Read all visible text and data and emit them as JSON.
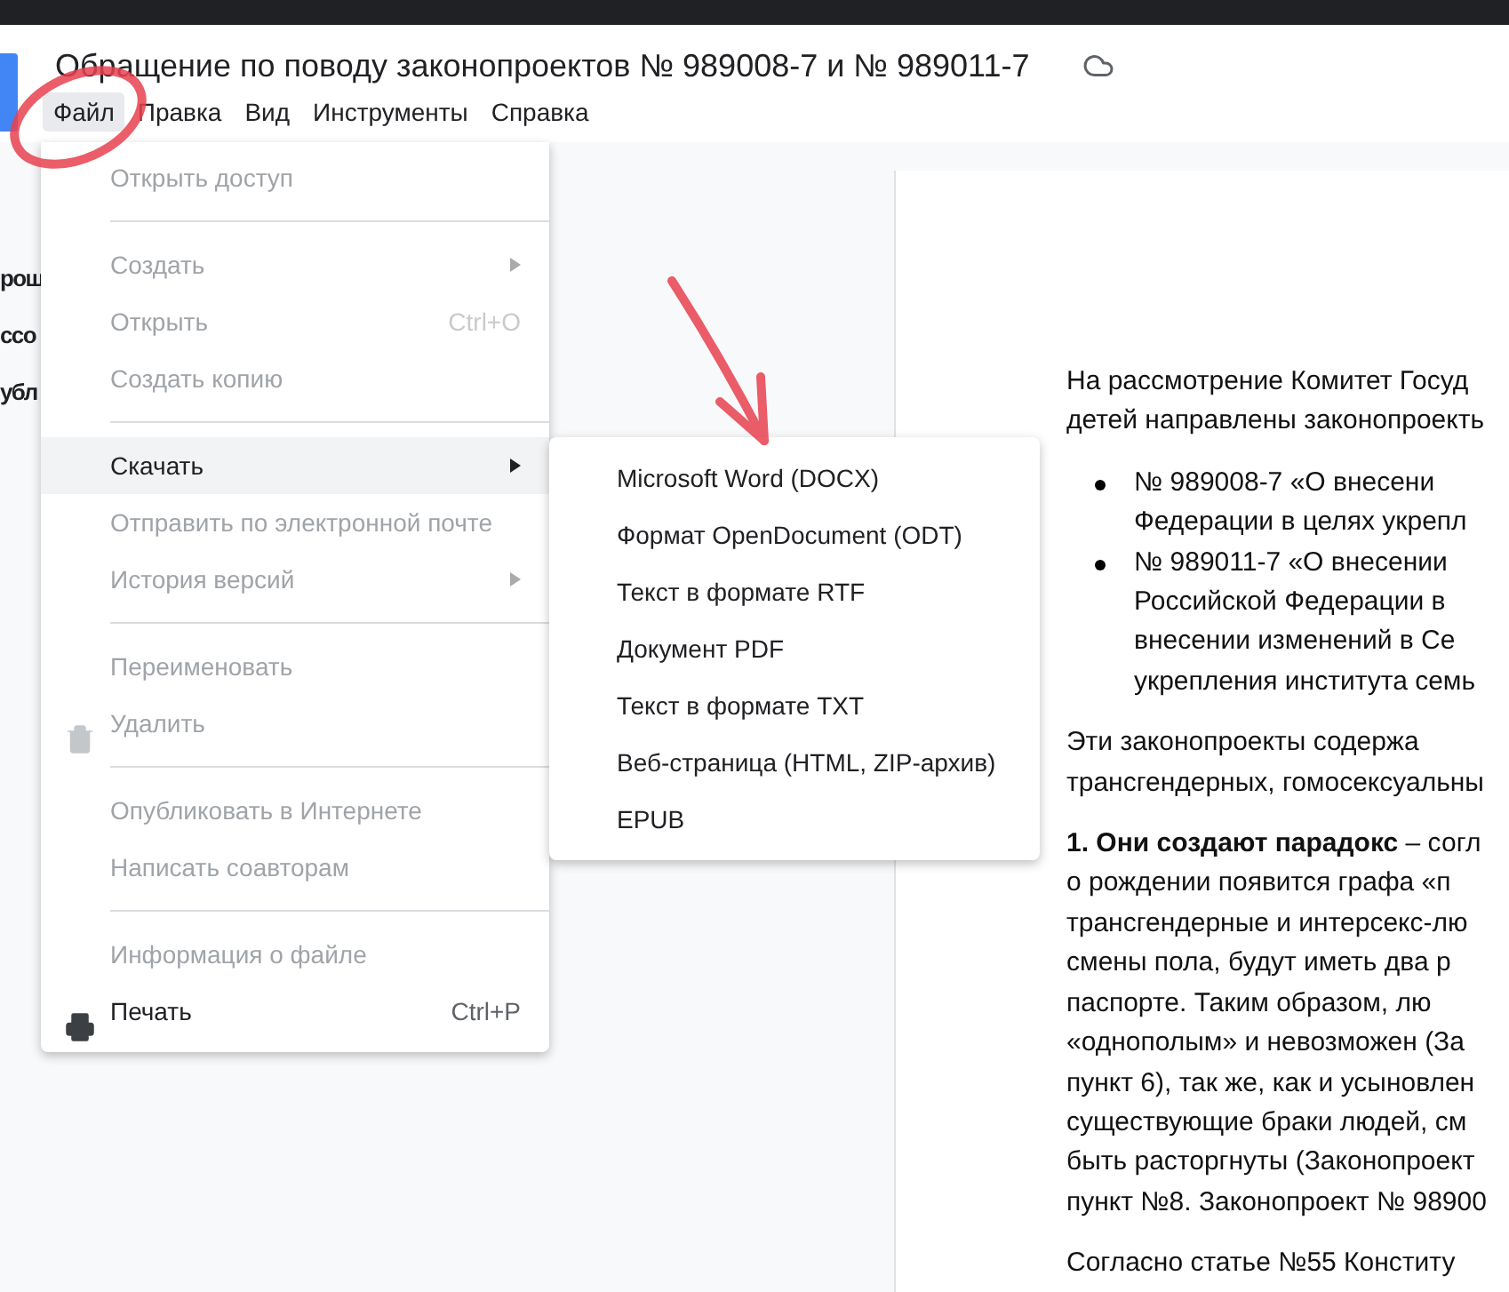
{
  "document_title": "Обращение по поводу законопроектов № 989008-7 и № 989011-7",
  "menubar": [
    {
      "label": "Файл",
      "selected": true
    },
    {
      "label": "Правка",
      "selected": false
    },
    {
      "label": "Вид",
      "selected": false
    },
    {
      "label": "Инструменты",
      "selected": false
    },
    {
      "label": "Справка",
      "selected": false
    }
  ],
  "outline": [
    "рош",
    "ссо",
    "убл"
  ],
  "file_menu": [
    {
      "kind": "item",
      "label": "Открыть доступ",
      "disabled": true,
      "selected": false
    },
    {
      "kind": "separator"
    },
    {
      "kind": "item",
      "label": "Создать",
      "disabled": true,
      "selected": false,
      "submenu": true
    },
    {
      "kind": "item",
      "label": "Открыть",
      "disabled": true,
      "selected": false,
      "shortcut": "Ctrl+O"
    },
    {
      "kind": "item",
      "label": "Создать копию",
      "disabled": true,
      "selected": false
    },
    {
      "kind": "separator"
    },
    {
      "kind": "item",
      "label": "Скачать",
      "disabled": false,
      "selected": true,
      "submenu": true
    },
    {
      "kind": "item",
      "label": "Отправить по электронной почте",
      "disabled": true,
      "selected": false
    },
    {
      "kind": "item",
      "label": "История версий",
      "disabled": true,
      "selected": false,
      "submenu": true
    },
    {
      "kind": "separator"
    },
    {
      "kind": "item",
      "label": "Переименовать",
      "disabled": true,
      "selected": false
    },
    {
      "kind": "trash",
      "label": "Удалить",
      "disabled": true,
      "selected": false
    },
    {
      "kind": "separator"
    },
    {
      "kind": "item",
      "label": "Опубликовать в Интернете",
      "disabled": true,
      "selected": false
    },
    {
      "kind": "item",
      "label": "Написать соавторам",
      "disabled": true,
      "selected": false
    },
    {
      "kind": "separator"
    },
    {
      "kind": "item",
      "label": "Информация о файле",
      "disabled": true,
      "selected": false
    },
    {
      "kind": "print",
      "label": "Печать",
      "disabled": false,
      "selected": false,
      "shortcut": "Ctrl+P"
    }
  ],
  "download_submenu": [
    "Microsoft Word (DOCX)",
    "Формат OpenDocument (ODT)",
    "Текст в формате RTF",
    "Документ PDF",
    "Текст в формате TXT",
    "Веб-страница (HTML, ZIP-архив)",
    "EPUB"
  ],
  "document": [
    {
      "kind": "paragraph",
      "lines": [
        "На рассмотрение Комитет Госуд",
        "детей направлены законопроекть"
      ]
    },
    {
      "kind": "bullet",
      "lines": [
        "№ 989008-7 «О внесени",
        "Федерации в целях укрепл"
      ]
    },
    {
      "kind": "bullet",
      "lines": [
        "№ 989011-7 «О внесении",
        "Российской Федерации в",
        "внесении изменений в Се",
        "укрепления института семь"
      ]
    },
    {
      "kind": "paragraph",
      "lines": [
        "Эти законопроекты содержа",
        "трансгендерных, гомосексуальны"
      ]
    },
    {
      "kind": "paragraph",
      "lines": [
        "**1. Они создают парадокс** – согл",
        "о рождении появится графа «п",
        "трансгендерные и интерсекс-лю",
        "смены пола, будут иметь два р",
        "паспорте. Таким образом, лю",
        "«однополым» и невозможен (За",
        "пункт 6), так же, как и усыновлен",
        "существующие браки людей, см",
        "быть расторгнуты (Законопроект",
        "пункт №8. Законопроект № 98900"
      ]
    },
    {
      "kind": "paragraph",
      "lines": [
        "Согласно статье №55 Конститу"
      ]
    }
  ]
}
